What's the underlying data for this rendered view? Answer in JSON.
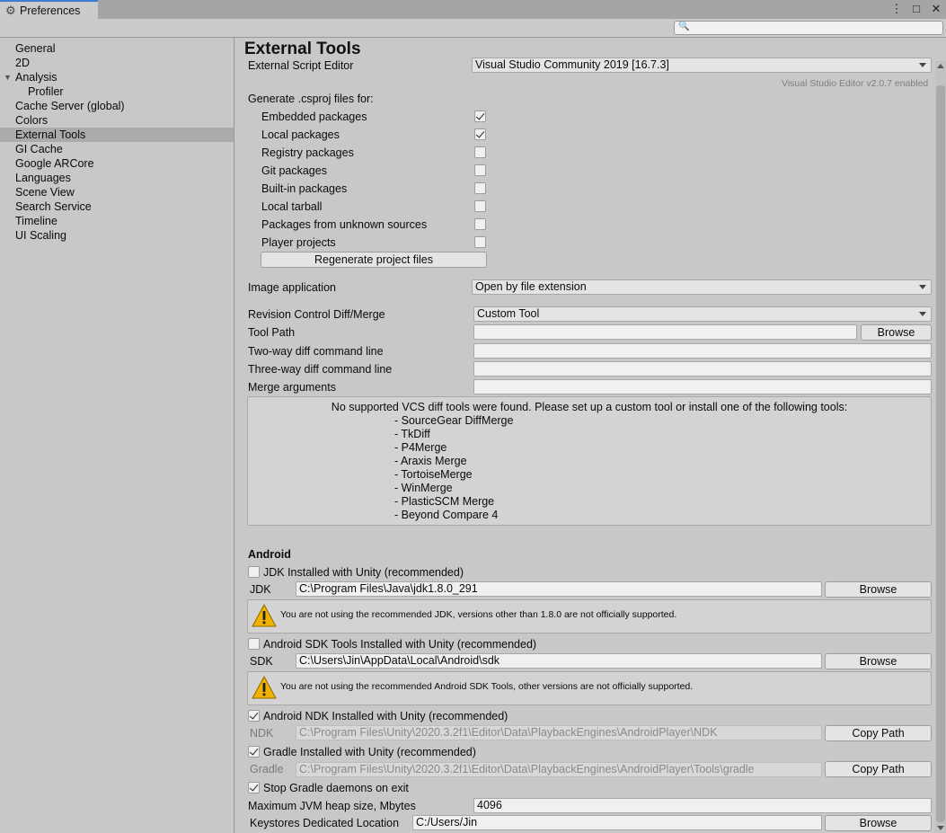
{
  "window": {
    "tab_title": "Preferences",
    "gear_icon": "gear-icon",
    "menu_icon": "⋮",
    "maximize_icon": "□",
    "close_icon": "✕"
  },
  "search": {
    "placeholder": ""
  },
  "sidebar": {
    "items": [
      {
        "label": "General"
      },
      {
        "label": "2D"
      },
      {
        "label": "Analysis"
      },
      {
        "label": "Profiler"
      },
      {
        "label": "Cache Server (global)"
      },
      {
        "label": "Colors"
      },
      {
        "label": "External Tools"
      },
      {
        "label": "GI Cache"
      },
      {
        "label": "Google ARCore"
      },
      {
        "label": "Languages"
      },
      {
        "label": "Scene View"
      },
      {
        "label": "Search Service"
      },
      {
        "label": "Timeline"
      },
      {
        "label": "UI Scaling"
      }
    ],
    "selected": "External Tools"
  },
  "main": {
    "title": "External Tools",
    "external_script_editor": {
      "label": "External Script Editor",
      "value": "Visual Studio Community 2019 [16.7.3]",
      "note": "Visual Studio Editor v2.0.7 enabled"
    },
    "csproj": {
      "heading": "Generate .csproj files for:",
      "options": [
        {
          "label": "Embedded packages",
          "checked": true
        },
        {
          "label": "Local packages",
          "checked": true
        },
        {
          "label": "Registry packages",
          "checked": false
        },
        {
          "label": "Git packages",
          "checked": false
        },
        {
          "label": "Built-in packages",
          "checked": false
        },
        {
          "label": "Local tarball",
          "checked": false
        },
        {
          "label": "Packages from unknown sources",
          "checked": false
        },
        {
          "label": "Player projects",
          "checked": false
        }
      ],
      "regenerate_button": "Regenerate project files"
    },
    "image_application": {
      "label": "Image application",
      "value": "Open by file extension"
    },
    "revision_control": {
      "label": "Revision Control Diff/Merge",
      "value": "Custom Tool"
    },
    "tool_path": {
      "label": "Tool Path",
      "value": "",
      "browse": "Browse"
    },
    "two_way": {
      "label": "Two-way diff command line",
      "value": ""
    },
    "three_way": {
      "label": "Three-way diff command line",
      "value": ""
    },
    "merge_args": {
      "label": "Merge arguments",
      "value": ""
    },
    "vcs_help": {
      "message": "No supported VCS diff tools were found. Please set up a custom tool or install one of the following tools:",
      "tools": [
        "- SourceGear DiffMerge",
        "- TkDiff",
        "- P4Merge",
        "- Araxis Merge",
        "- TortoiseMerge",
        "- WinMerge",
        "- PlasticSCM Merge",
        "- Beyond Compare 4"
      ]
    },
    "android": {
      "heading": "Android",
      "jdk_installed": {
        "label": "JDK Installed with Unity (recommended)",
        "checked": false
      },
      "jdk": {
        "label": "JDK",
        "value": "C:\\Program Files\\Java\\jdk1.8.0_291",
        "browse": "Browse"
      },
      "jdk_warning": "You are not using the recommended JDK, versions other than 1.8.0 are not officially supported.",
      "sdk_installed": {
        "label": "Android SDK Tools Installed with Unity (recommended)",
        "checked": false
      },
      "sdk": {
        "label": "SDK",
        "value": "C:\\Users\\Jin\\AppData\\Local\\Android\\sdk",
        "browse": "Browse"
      },
      "sdk_warning": "You are not using the recommended Android SDK Tools, other versions are not officially supported.",
      "ndk_installed": {
        "label": "Android NDK Installed with Unity (recommended)",
        "checked": true
      },
      "ndk": {
        "label": "NDK",
        "value": "C:\\Program Files\\Unity\\2020.3.2f1\\Editor\\Data\\PlaybackEngines\\AndroidPlayer\\NDK",
        "copy": "Copy Path"
      },
      "gradle_installed": {
        "label": "Gradle Installed with Unity (recommended)",
        "checked": true
      },
      "gradle": {
        "label": "Gradle",
        "value": "C:\\Program Files\\Unity\\2020.3.2f1\\Editor\\Data\\PlaybackEngines\\AndroidPlayer\\Tools\\gradle",
        "copy": "Copy Path"
      },
      "stop_gradle": {
        "label": "Stop Gradle daemons on exit",
        "checked": true
      },
      "max_jvm": {
        "label": "Maximum JVM heap size, Mbytes",
        "value": "4096"
      },
      "keystores": {
        "label": "Keystores Dedicated Location",
        "value": "C:/Users/Jin",
        "browse": "Browse"
      }
    }
  }
}
